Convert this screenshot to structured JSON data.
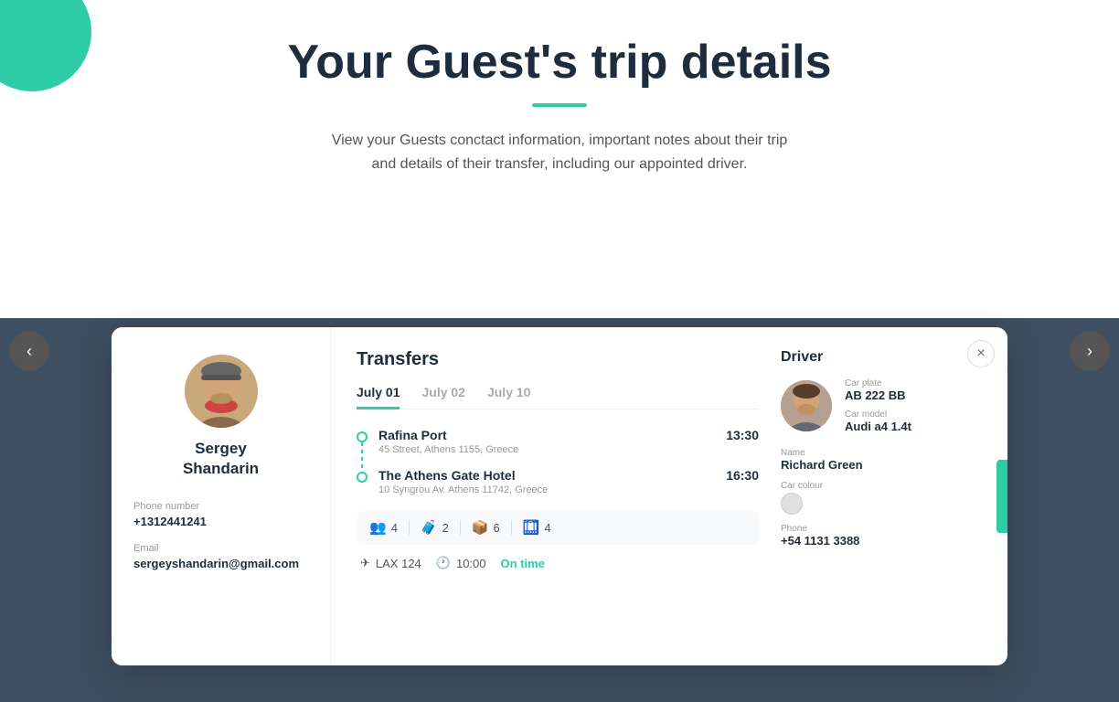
{
  "header": {
    "title": "Your Guest's trip details",
    "underline_color": "#2ecda7",
    "subtitle_line1": "View your Guests conctact information, important notes about their trip",
    "subtitle_line2": "and details of their transfer, including our appointed driver."
  },
  "guest": {
    "name": "Sergey\nShandarin",
    "name_line1": "Sergey",
    "name_line2": "Shandarin",
    "phone_label": "Phone number",
    "phone_value": "+1312441241",
    "email_label": "Email",
    "email_value": "sergeyshandarin@gmail.com"
  },
  "transfers": {
    "section_title": "Transfers",
    "tabs": [
      {
        "label": "July 01",
        "active": true
      },
      {
        "label": "July 02",
        "active": false
      },
      {
        "label": "July 10",
        "active": false
      }
    ],
    "routes": [
      {
        "name": "Rafina Port",
        "address": "45 Street, Athens 1155, Greece",
        "time": "13:30"
      },
      {
        "name": "The Athens Gate Hotel",
        "address": "10 Syngrou Av. Athens 11742, Greece",
        "time": "16:30"
      }
    ],
    "stats": [
      {
        "icon": "👥",
        "value": "4"
      },
      {
        "icon": "🧳",
        "value": "2"
      },
      {
        "icon": "📦",
        "value": "6"
      },
      {
        "icon": "🛄",
        "value": "4"
      }
    ],
    "flight": {
      "flight_icon": "✈",
      "flight_number": "LAX 124",
      "clock_icon": "🕐",
      "time": "10:00",
      "status": "On time"
    }
  },
  "driver": {
    "section_title": "Driver",
    "car_plate_label": "Car plate",
    "car_plate_value": "AB 222 BB",
    "car_model_label": "Car model",
    "car_model_value": "Audi a4 1.4t",
    "name_label": "Name",
    "name_value": "Richard Green",
    "car_colour_label": "Car colour",
    "phone_label": "Phone",
    "phone_value": "+54 1131 3388"
  },
  "ui": {
    "close_button": "×",
    "prev_arrow": "‹",
    "next_arrow": "›",
    "accent_color": "#2ecda7"
  }
}
